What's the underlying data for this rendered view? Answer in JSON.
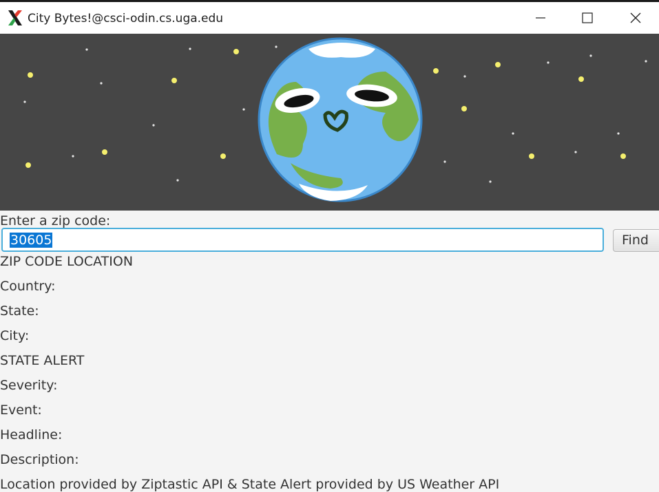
{
  "window": {
    "title": "City Bytes!@csci-odin.cs.uga.edu",
    "app_icon": "x-logo-icon",
    "controls": [
      "minimize-icon",
      "maximize-icon",
      "close-icon"
    ]
  },
  "banner": {
    "image": "cartoon-earth-icon",
    "background": "#464646"
  },
  "search": {
    "prompt": "Enter a zip code:",
    "value": "30605",
    "button_label": "Find"
  },
  "location": {
    "heading": "ZIP CODE LOCATION",
    "country_label": "Country:",
    "state_label": "State:",
    "city_label": "City:"
  },
  "alert": {
    "heading": "STATE ALERT",
    "severity_label": "Severity:",
    "event_label": "Event:",
    "headline_label": "Headline:",
    "description_label": "Description:"
  },
  "footer": {
    "credit": "Location provided by Ziptastic API & State Alert provided by US Weather API"
  },
  "colors": {
    "accent": "#4aaedb",
    "selection": "#0a76d4",
    "text": "#333333"
  }
}
